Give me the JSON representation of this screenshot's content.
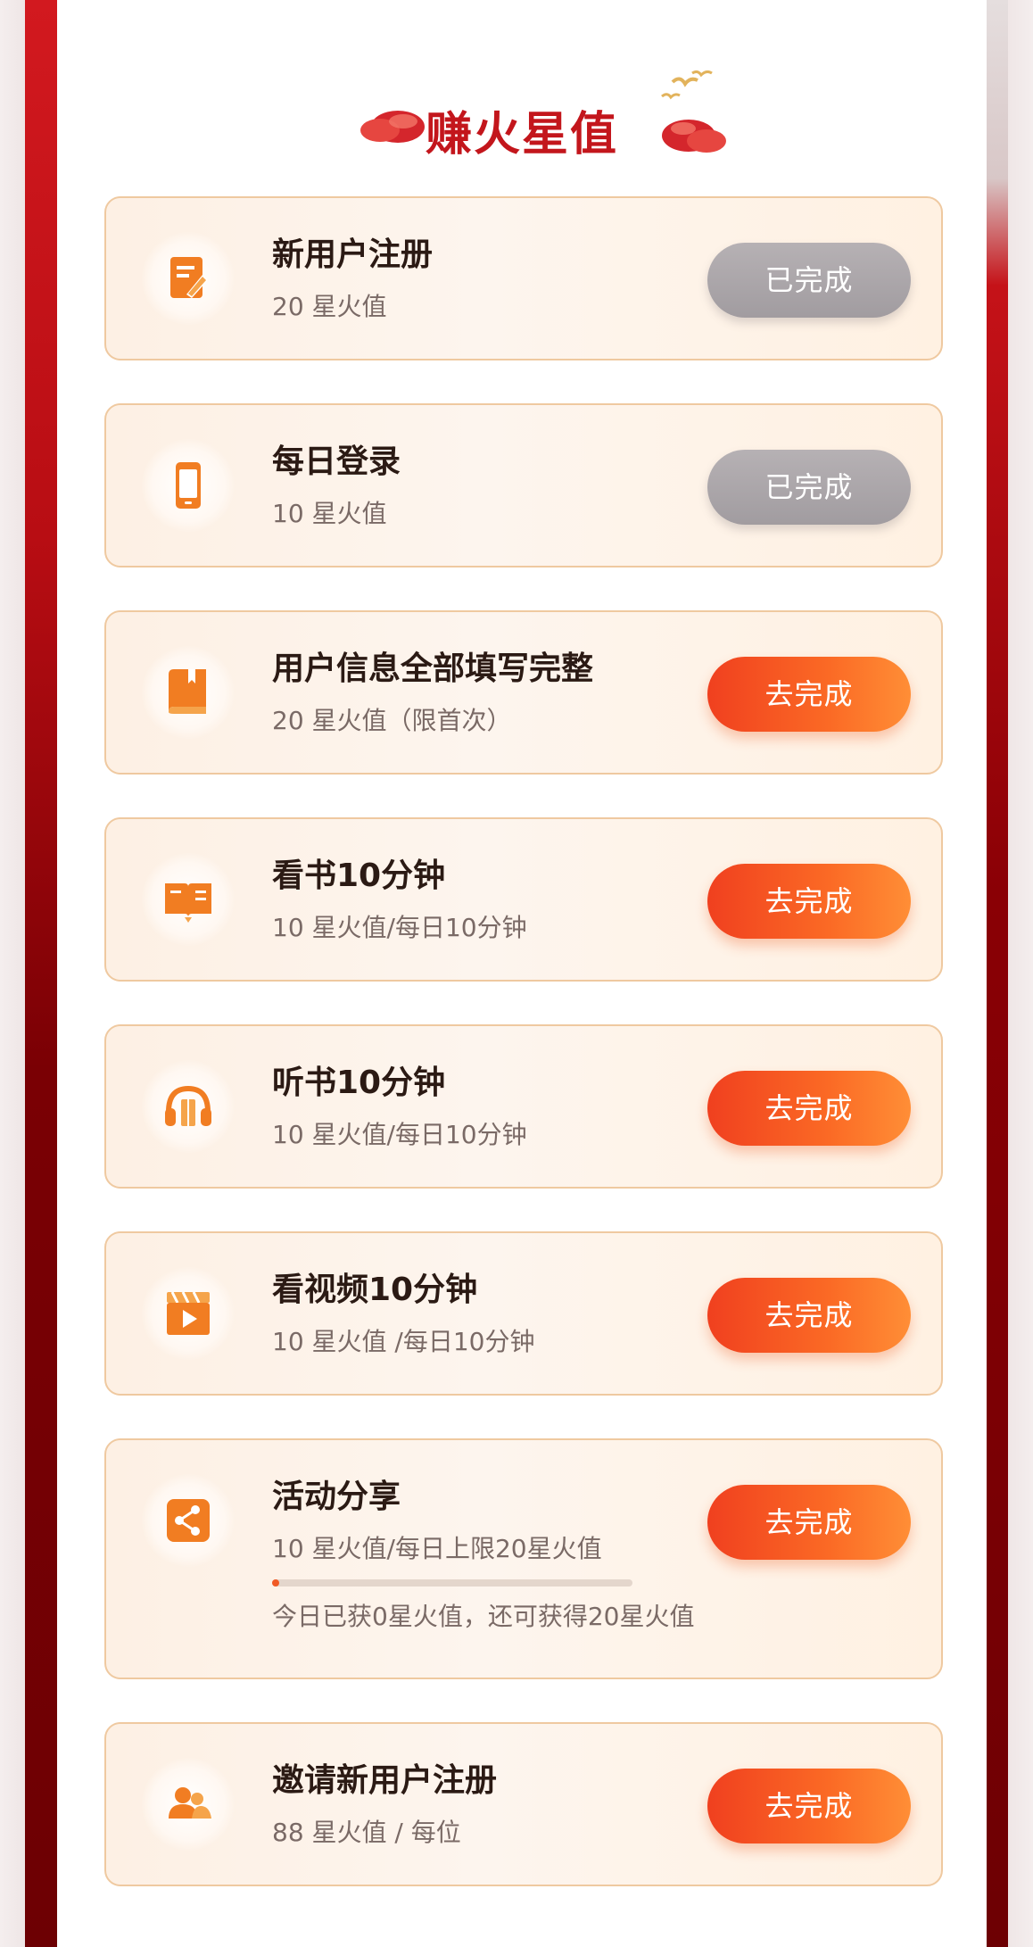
{
  "header": {
    "title": "赚火星值"
  },
  "colors": {
    "accent": "#f15a24",
    "brand_red": "#c3161c",
    "done_gray": "#a9a4a8"
  },
  "tasks": [
    {
      "title": "新用户注册",
      "reward": "20 星火值",
      "button": "已完成",
      "status": "done",
      "icon": "edit-document-icon"
    },
    {
      "title": "每日登录",
      "reward": "10 星火值",
      "button": "已完成",
      "status": "done",
      "icon": "mobile-phone-icon"
    },
    {
      "title": "用户信息全部填写完整",
      "reward": "20 星火值（限首次）",
      "button": "去完成",
      "status": "todo",
      "icon": "book-icon"
    },
    {
      "title": "看书10分钟",
      "reward": "10 星火值/每日10分钟",
      "button": "去完成",
      "status": "todo",
      "icon": "open-book-icon"
    },
    {
      "title": "听书10分钟",
      "reward": "10 星火值/每日10分钟",
      "button": "去完成",
      "status": "todo",
      "icon": "headphones-icon"
    },
    {
      "title": "看视频10分钟",
      "reward": "10 星火值 /每日10分钟",
      "button": "去完成",
      "status": "todo",
      "icon": "video-play-icon"
    },
    {
      "title": "活动分享",
      "reward": "10 星火值/每日上限20星火值",
      "button": "去完成",
      "status": "todo",
      "icon": "share-icon",
      "progress": 0.02,
      "note": "今日已获0星火值，还可获得20星火值"
    },
    {
      "title": "邀请新用户注册",
      "reward": "88 星火值 / 每位",
      "button": "去完成",
      "status": "todo",
      "icon": "users-icon"
    }
  ]
}
